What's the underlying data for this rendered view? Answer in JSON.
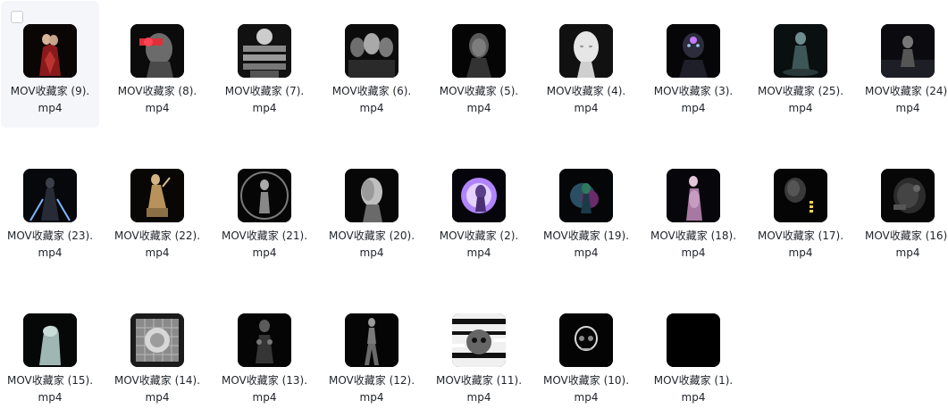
{
  "files": [
    {
      "name": "MOV收藏家 (9).mp4",
      "thumb": "figure-red",
      "selected": true
    },
    {
      "name": "MOV收藏家 (8).mp4",
      "thumb": "head-red"
    },
    {
      "name": "MOV收藏家 (7).mp4",
      "thumb": "stripes-grey"
    },
    {
      "name": "MOV收藏家 (6).mp4",
      "thumb": "trio-heads"
    },
    {
      "name": "MOV收藏家 (5).mp4",
      "thumb": "head-dark"
    },
    {
      "name": "MOV收藏家 (4).mp4",
      "thumb": "head-white"
    },
    {
      "name": "MOV收藏家 (3).mp4",
      "thumb": "head-purple"
    },
    {
      "name": "MOV收藏家 (25).mp4",
      "thumb": "figure-teal"
    },
    {
      "name": "MOV收藏家 (24).mp4",
      "thumb": "figure-room"
    },
    {
      "name": "MOV收藏家 (23).mp4",
      "thumb": "figure-blades"
    },
    {
      "name": "MOV收藏家 (22).mp4",
      "thumb": "statue-gold"
    },
    {
      "name": "MOV收藏家 (21).mp4",
      "thumb": "ring-figure"
    },
    {
      "name": "MOV收藏家 (20).mp4",
      "thumb": "head-profile"
    },
    {
      "name": "MOV收藏家 (2).mp4",
      "thumb": "orb-purple"
    },
    {
      "name": "MOV收藏家 (19).mp4",
      "thumb": "figure-glow"
    },
    {
      "name": "MOV收藏家 (18).mp4",
      "thumb": "figure-pink"
    },
    {
      "name": "MOV收藏家 (17).mp4",
      "thumb": "head-yellow"
    },
    {
      "name": "MOV收藏家 (16).mp4",
      "thumb": "machine-head"
    },
    {
      "name": "MOV收藏家 (15).mp4",
      "thumb": "hand-statue"
    },
    {
      "name": "MOV收藏家 (14).mp4",
      "thumb": "grid-sculpture"
    },
    {
      "name": "MOV收藏家 (13).mp4",
      "thumb": "skeleton-dark"
    },
    {
      "name": "MOV收藏家 (12).mp4",
      "thumb": "walking-figure"
    },
    {
      "name": "MOV收藏家 (11).mp4",
      "thumb": "glitch-skull"
    },
    {
      "name": "MOV收藏家 (10).mp4",
      "thumb": "glass-skull"
    },
    {
      "name": "MOV收藏家 (1).mp4",
      "thumb": "black"
    }
  ]
}
